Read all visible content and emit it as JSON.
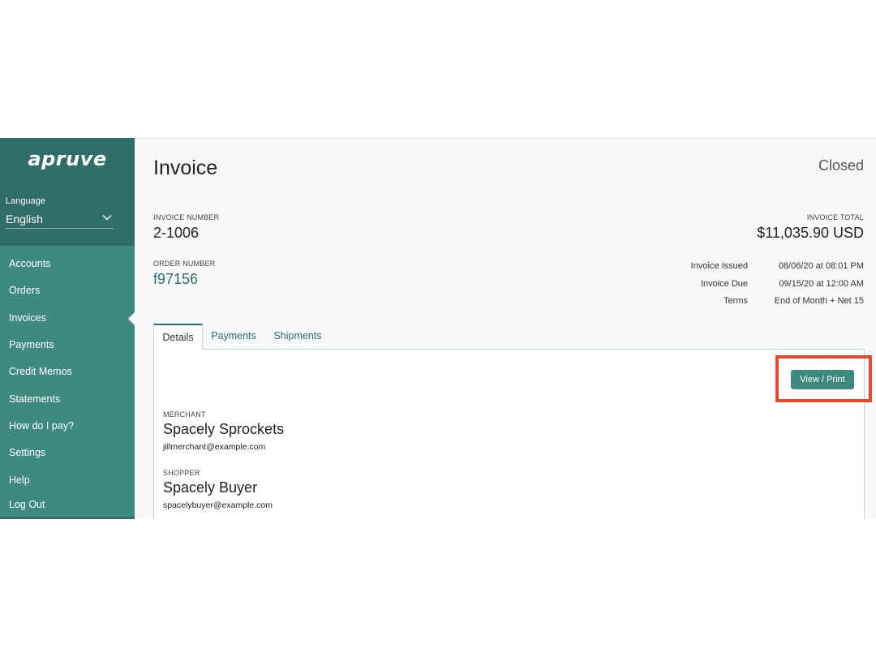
{
  "sidebar": {
    "logo": "apruve",
    "language_label": "Language",
    "language_value": "English",
    "items": [
      {
        "label": "Accounts"
      },
      {
        "label": "Orders"
      },
      {
        "label": "Invoices"
      },
      {
        "label": "Payments"
      },
      {
        "label": "Credit Memos"
      },
      {
        "label": "Statements"
      },
      {
        "label": "How do I pay?"
      },
      {
        "label": "Settings"
      },
      {
        "label": "Help"
      },
      {
        "label": "Log Out"
      }
    ],
    "active_item": "Invoices"
  },
  "header": {
    "title": "Invoice",
    "status": "Closed"
  },
  "invoice": {
    "number_label": "INVOICE NUMBER",
    "number": "2-1006",
    "order_label": "ORDER NUMBER",
    "order_number": "f97156",
    "total_label": "INVOICE TOTAL",
    "total": "$11,035.90 USD",
    "meta": [
      {
        "label": "Invoice Issued",
        "value": "08/06/20 at 08:01 PM"
      },
      {
        "label": "Invoice Due",
        "value": "09/15/20 at 12:00 AM"
      },
      {
        "label": "Terms",
        "value": "End of Month + Net 15"
      }
    ]
  },
  "tabs": [
    {
      "label": "Details"
    },
    {
      "label": "Payments"
    },
    {
      "label": "Shipments"
    }
  ],
  "details": {
    "view_print_label": "View / Print",
    "merchant_label": "MERCHANT",
    "merchant_name": "Spacely Sprockets",
    "merchant_email": "jillmerchant@example.com",
    "shopper_label": "SHOPPER",
    "shopper_name": "Spacely Buyer",
    "shopper_email": "spacelybuyer@example.com"
  },
  "colors": {
    "sidebar": "#3e8a83",
    "sidebar_dark": "#2f6d68",
    "highlight": "#e34b2f",
    "background": "#f7f9fa"
  }
}
